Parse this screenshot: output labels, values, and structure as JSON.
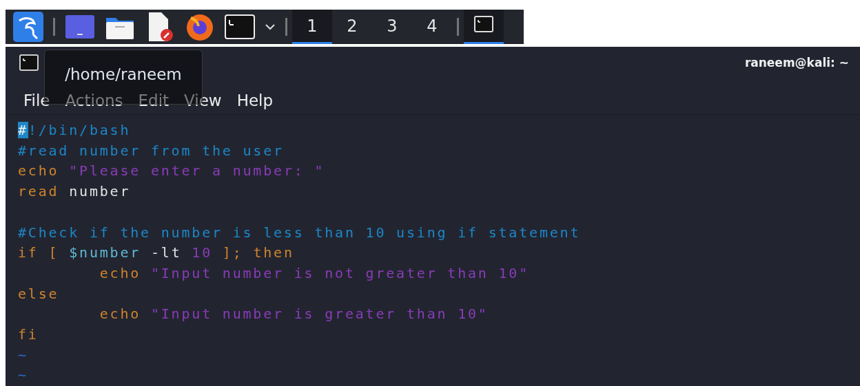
{
  "taskbar": {
    "launchers": [
      {
        "kind": "menu"
      },
      {
        "kind": "desktop"
      },
      {
        "kind": "files"
      },
      {
        "kind": "editor"
      },
      {
        "kind": "browser"
      },
      {
        "kind": "terminal"
      }
    ],
    "workspaces": [
      {
        "label": "1",
        "selected": true
      },
      {
        "label": "2",
        "selected": false
      },
      {
        "label": "3",
        "selected": false
      },
      {
        "label": "4",
        "selected": false
      }
    ],
    "tasks": [
      {
        "selected": true
      }
    ]
  },
  "window": {
    "title": "raneem@kali: ~",
    "tooltip": "/home/raneem",
    "menu": [
      "File",
      "Actions",
      "Edit",
      "View",
      "Help"
    ]
  },
  "editor": {
    "lines": [
      [
        {
          "text": "#",
          "kind": "cursor"
        },
        {
          "text": "!/bin/bash",
          "kind": "comment"
        }
      ],
      [
        {
          "text": "#read number from the user",
          "kind": "comment"
        }
      ],
      [
        {
          "text": "echo ",
          "kind": "keyword"
        },
        {
          "text": "\"Please enter a number: \"",
          "kind": "string"
        }
      ],
      [
        {
          "text": "read ",
          "kind": "keyword"
        },
        {
          "text": "number",
          "kind": "plain"
        }
      ],
      {
        "kind": "blank"
      },
      [
        {
          "text": "#Check if the number is less than 10 using if statement",
          "kind": "comment"
        }
      ],
      [
        {
          "text": "if [ ",
          "kind": "keyword"
        },
        {
          "text": "$number",
          "kind": "variable"
        },
        {
          "text": " -lt ",
          "kind": "plain"
        },
        {
          "text": "10",
          "kind": "number"
        },
        {
          "text": " ]; then",
          "kind": "keyword"
        }
      ],
      [
        {
          "text": "        echo ",
          "kind": "keyword"
        },
        {
          "text": "\"Input number is not greater than 10\"",
          "kind": "string"
        }
      ],
      [
        {
          "text": "else",
          "kind": "keyword"
        }
      ],
      [
        {
          "text": "        echo ",
          "kind": "keyword"
        },
        {
          "text": "\"Input number is greater than 10\"",
          "kind": "string"
        }
      ],
      [
        {
          "text": "fi",
          "kind": "keyword"
        }
      ],
      [
        {
          "text": "~",
          "kind": "tilde"
        }
      ],
      [
        {
          "text": "~",
          "kind": "tilde"
        }
      ]
    ]
  }
}
